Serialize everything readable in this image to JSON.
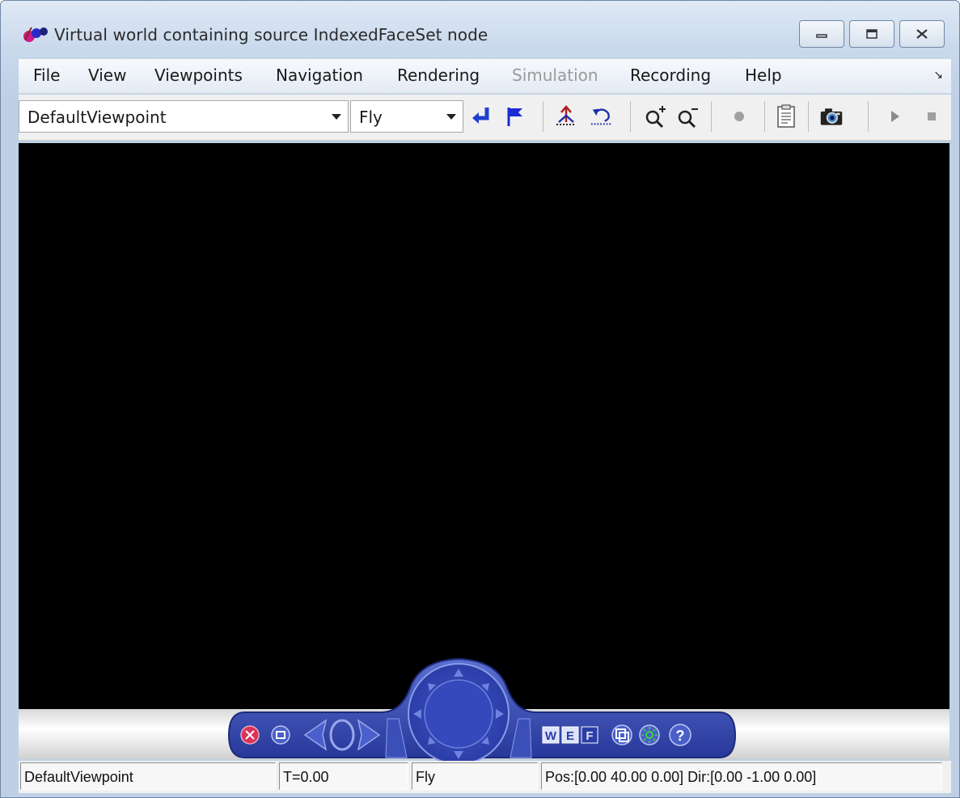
{
  "window": {
    "title": "Virtual world containing source IndexedFaceSet node",
    "controls": [
      "minimize-icon",
      "maximize-icon",
      "close-icon"
    ]
  },
  "menu": {
    "items": [
      {
        "label": "File",
        "enabled": true
      },
      {
        "label": "View",
        "enabled": true
      },
      {
        "label": "Viewpoints",
        "enabled": true
      },
      {
        "label": "Navigation",
        "enabled": true
      },
      {
        "label": "Rendering",
        "enabled": true
      },
      {
        "label": "Simulation",
        "enabled": false
      },
      {
        "label": "Recording",
        "enabled": true
      },
      {
        "label": "Help",
        "enabled": true
      }
    ],
    "corner_glyph": "↘"
  },
  "toolbar": {
    "viewpoint_select": "DefaultViewpoint",
    "navigation_select": "Fly",
    "icons": [
      "return-to-viewpoint-icon",
      "create-viewpoint-icon",
      "straighten-up-icon",
      "undo-move-icon",
      "zoom-in-icon",
      "zoom-out-icon",
      "record-icon",
      "edit-world-icon",
      "snapshot-icon",
      "play-icon",
      "stop-icon"
    ]
  },
  "nav_panel": {
    "mode_buttons": [
      "W",
      "E",
      "F"
    ],
    "help_label": "?"
  },
  "status": {
    "viewpoint": "DefaultViewpoint",
    "time": "T=0.00",
    "mode": "Fly",
    "position": "Pos:[0.00 40.00 0.00] Dir:[0.00 -1.00 0.00]"
  },
  "colors": {
    "viewport_bg": "#000000",
    "nav_panel": "#3a4fae",
    "accent_blue": "#1f3fcf",
    "flag_blue": "#1a2bd6",
    "disabled_text": "#9a9a9a"
  }
}
